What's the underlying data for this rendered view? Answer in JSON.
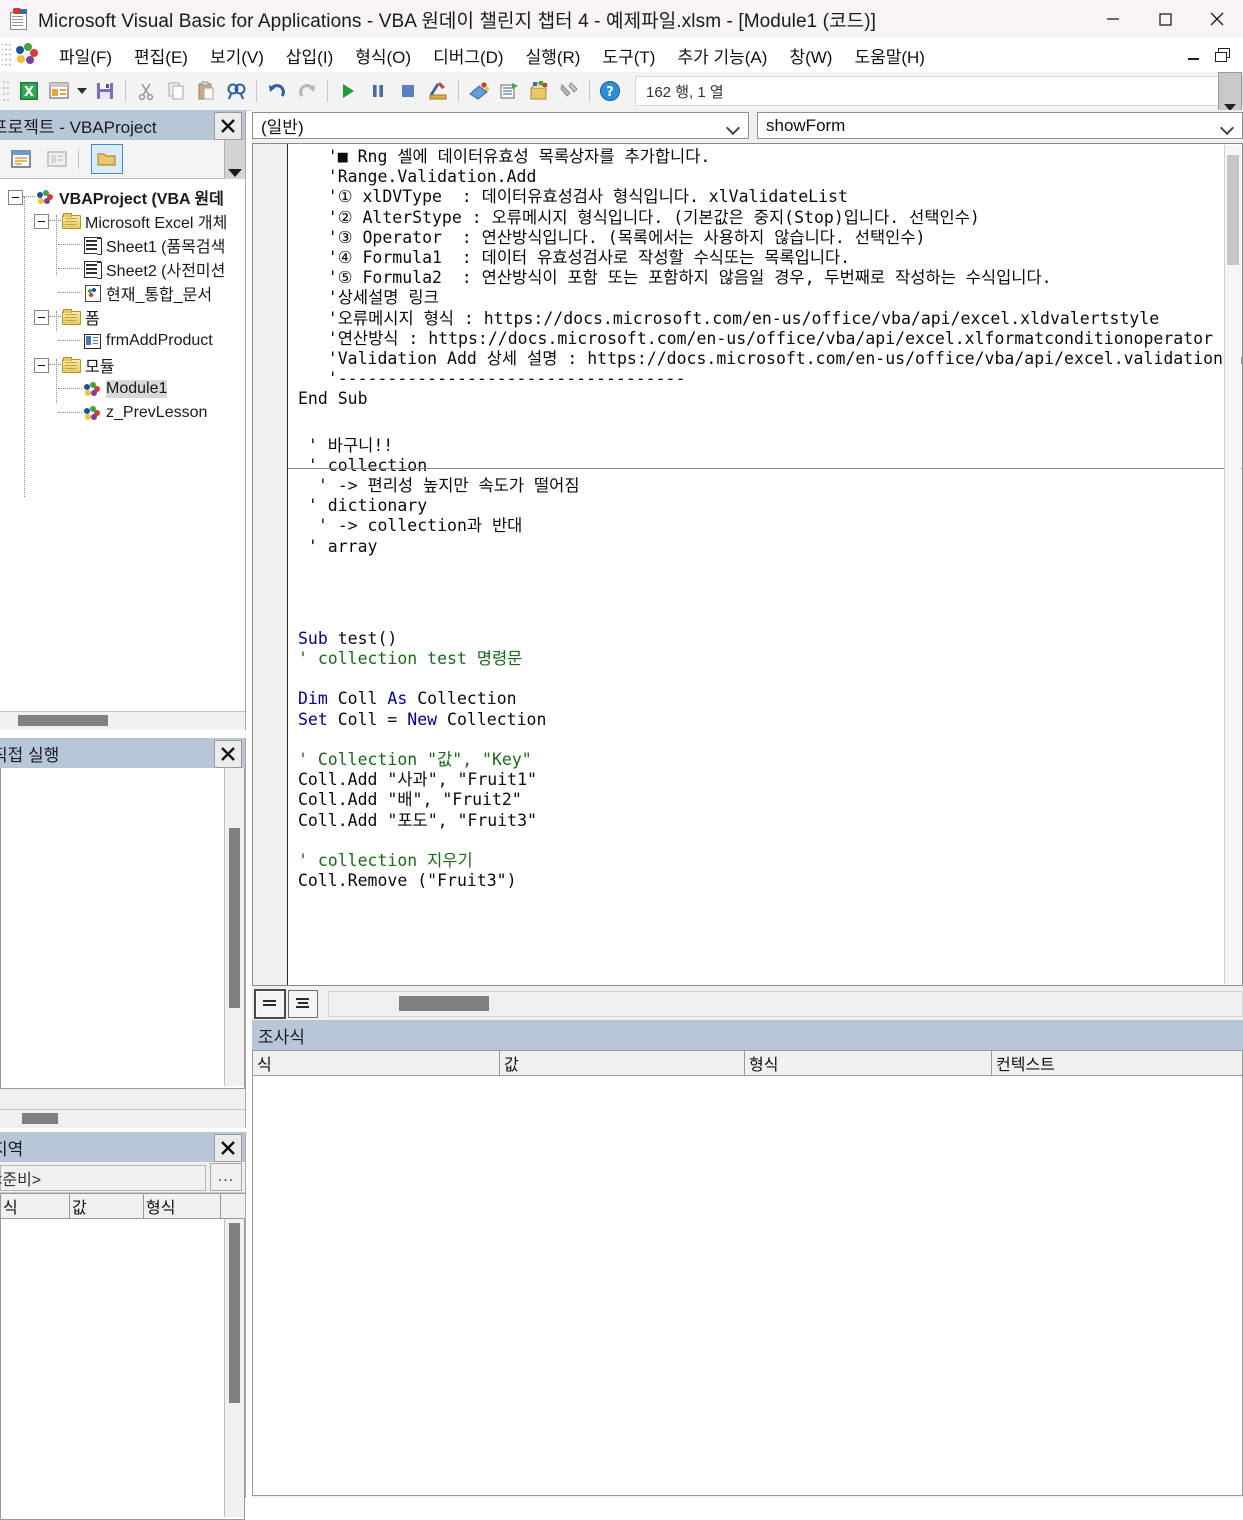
{
  "window": {
    "title": "Microsoft Visual Basic for Applications - VBA 원데이 챌린지 챕터 4 - 예제파일.xlsm - [Module1 (코드)]",
    "minimize": "—",
    "maximize": "□",
    "close": "✕"
  },
  "menubar": {
    "items": [
      {
        "label": "파일(F)",
        "key": "F"
      },
      {
        "label": "편집(E)",
        "key": "E"
      },
      {
        "label": "보기(V)",
        "key": "V"
      },
      {
        "label": "삽입(I)",
        "key": "I"
      },
      {
        "label": "형식(O)",
        "key": "O"
      },
      {
        "label": "디버그(D)",
        "key": "D"
      },
      {
        "label": "실행(R)",
        "key": "R"
      },
      {
        "label": "도구(T)",
        "key": "T"
      },
      {
        "label": "추가 기능(A)",
        "key": "A"
      },
      {
        "label": "창(W)",
        "key": "W"
      },
      {
        "label": "도움말(H)",
        "key": "H"
      }
    ]
  },
  "toolbar": {
    "status": "162 행, 1 열",
    "buttons": [
      "excel-view-icon",
      "insert-userform-icon",
      "save-icon",
      "cut-icon",
      "copy-icon",
      "paste-icon",
      "find-icon",
      "undo-icon",
      "redo-icon",
      "run-icon",
      "break-icon",
      "reset-icon",
      "design-mode-icon",
      "project-explorer-icon",
      "properties-window-icon",
      "object-browser-icon",
      "toolbox-icon",
      "help-icon"
    ]
  },
  "project_explorer": {
    "title": "프로젝트 - VBAProject",
    "close_label": "✕",
    "toolbar": [
      "view-code-icon",
      "view-object-icon",
      "toggle-folders-icon"
    ],
    "tree": [
      {
        "label": "VBAProject (VBA 원데",
        "level": 0,
        "icon": "project-icon",
        "expander": "minus"
      },
      {
        "label": "Microsoft Excel 개체",
        "level": 1,
        "icon": "folder-icon",
        "expander": "minus"
      },
      {
        "label": "Sheet1 (품목검색",
        "level": 2,
        "icon": "sheet-icon",
        "expander": "none"
      },
      {
        "label": "Sheet2 (사전미션",
        "level": 2,
        "icon": "sheet-icon",
        "expander": "none"
      },
      {
        "label": "현재_통합_문서",
        "level": 2,
        "icon": "workbook-icon",
        "expander": "none"
      },
      {
        "label": "폼",
        "level": 1,
        "icon": "folder-icon",
        "expander": "minus"
      },
      {
        "label": "frmAddProduct",
        "level": 2,
        "icon": "userform-icon",
        "expander": "none"
      },
      {
        "label": "모듈",
        "level": 1,
        "icon": "folder-icon",
        "expander": "minus"
      },
      {
        "label": "Module1",
        "level": 2,
        "icon": "module-icon",
        "expander": "none",
        "selected": true
      },
      {
        "label": "z_PrevLesson",
        "level": 2,
        "icon": "module-icon",
        "expander": "none"
      }
    ]
  },
  "immediate_window": {
    "title": "직접 실행",
    "close_label": "✕",
    "content": ""
  },
  "locals_window": {
    "title": "지역",
    "close_label": "✕",
    "context": "<준비>",
    "context_button": "...",
    "columns": [
      "식",
      "값",
      "형식"
    ],
    "rows": []
  },
  "code_window": {
    "object_dropdown": "(일반)",
    "procedure_dropdown": "showForm",
    "view_buttons": [
      "procedure-view",
      "full-module-view"
    ],
    "lines": [
      {
        "text": "   '■ Rng 셀에 데이터유효성 목록상자를 추가합니다.",
        "type": "comment"
      },
      {
        "text": "   'Range.Validation.Add",
        "type": "comment"
      },
      {
        "text": "   '① xlDVType  : 데이터유효성검사 형식입니다. xlValidateList",
        "type": "comment"
      },
      {
        "text": "   '② AlterStype : 오류메시지 형식입니다. (기본값은 중지(Stop)입니다. 선택인수)",
        "type": "comment"
      },
      {
        "text": "   '③ Operator  : 연산방식입니다. (목록에서는 사용하지 않습니다. 선택인수)",
        "type": "comment"
      },
      {
        "text": "   '④ Formula1  : 데이터 유효성검사로 작성할 수식또는 목록입니다.",
        "type": "comment"
      },
      {
        "text": "   '⑤ Formula2  : 연산방식이 포함 또는 포함하지 않음일 경우, 두번째로 작성하는 수식입니다.",
        "type": "comment"
      },
      {
        "text": "   '상세설명 링크",
        "type": "comment"
      },
      {
        "text": "   '오류메시지 형식 : https://docs.microsoft.com/en-us/office/vba/api/excel.xldvalertstyle",
        "type": "comment"
      },
      {
        "text": "   '연산방식 : https://docs.microsoft.com/en-us/office/vba/api/excel.xlformatconditionoperator",
        "type": "comment"
      },
      {
        "text": "   'Validation Add 상세 설명 : https://docs.microsoft.com/en-us/office/vba/api/excel.validation.a",
        "type": "comment"
      },
      {
        "text": "   '-----------------------------------",
        "type": "comment"
      },
      {
        "text": "",
        "type": "blank"
      },
      {
        "text": "",
        "type": "blank"
      },
      {
        "text": "End Sub",
        "type": "keyword"
      }
    ],
    "lines2": [
      {
        "text": "",
        "type": "blank"
      },
      {
        "text": "",
        "type": "blank"
      },
      {
        "text": " ' 바구니!!",
        "type": "comment"
      },
      {
        "text": " ' collection",
        "type": "comment"
      },
      {
        "text": "  ' -> 편리성 높지만 속도가 떨어짐",
        "type": "comment"
      },
      {
        "text": " ' dictionary",
        "type": "comment"
      },
      {
        "text": "  ' -> collection과 반대",
        "type": "comment"
      },
      {
        "text": " ' array",
        "type": "comment"
      },
      {
        "text": "",
        "type": "blank"
      },
      {
        "text": "",
        "type": "blank"
      },
      {
        "text": "",
        "type": "blank"
      },
      {
        "text": "",
        "type": "blank"
      },
      {
        "text": "",
        "type": "blank"
      },
      {
        "text": "Sub test()",
        "type": "code"
      },
      {
        "text": "' collection test 명령문",
        "type": "comment"
      },
      {
        "text": "",
        "type": "blank"
      },
      {
        "text": "Dim Coll As Collection",
        "type": "code"
      },
      {
        "text": "Set Coll = New Collection",
        "type": "code"
      },
      {
        "text": "",
        "type": "blank"
      },
      {
        "text": "' Collection \"값\", \"Key\"",
        "type": "comment"
      },
      {
        "text": "Coll.Add \"사과\", \"Fruit1\"",
        "type": "code"
      },
      {
        "text": "Coll.Add \"배\", \"Fruit2\"",
        "type": "code"
      },
      {
        "text": "Coll.Add \"포도\", \"Fruit3\"",
        "type": "code"
      },
      {
        "text": "",
        "type": "blank"
      },
      {
        "text": "' collection 지우기",
        "type": "comment"
      },
      {
        "text": "Coll.Remove (\"Fruit3\")",
        "type": "code"
      }
    ]
  },
  "watch_window": {
    "title": "조사식",
    "columns": [
      "식",
      "값",
      "형식",
      "컨텍스트"
    ],
    "rows": []
  },
  "colors": {
    "comment": "#176b17",
    "keyword": "#00009c",
    "code": "#0b0b0b",
    "panel_title_bg": "#b7c7d8",
    "toolbar_bg": "#f3f3f3"
  }
}
